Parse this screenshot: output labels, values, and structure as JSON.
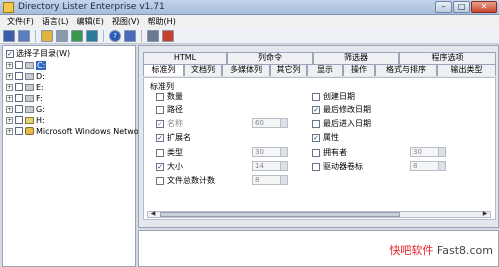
{
  "window": {
    "title": "Directory Lister Enterprise v1.71"
  },
  "menu": [
    "文件(F)",
    "语言(L)",
    "编辑(E)",
    "视图(V)",
    "帮助(H)"
  ],
  "toolbar": {
    "icons": [
      "save-icon",
      "save-all-icon",
      "open-folder-icon",
      "print-icon",
      "export-icon",
      "export-html-icon",
      "help-icon",
      "about-icon",
      "settings-icon",
      "exit-icon"
    ]
  },
  "tree": {
    "root_label": "选择子目录(W)",
    "drives": [
      {
        "label": "C:",
        "selected": true
      },
      {
        "label": "D:",
        "selected": false
      },
      {
        "label": "E:",
        "selected": false
      },
      {
        "label": "F:",
        "selected": false
      },
      {
        "label": "G:",
        "selected": false
      },
      {
        "label": "H:",
        "selected": false
      },
      {
        "label": "Microsoft Windows Network",
        "selected": false
      }
    ]
  },
  "tabs_top": [
    "HTML",
    "列命令",
    "筛选器",
    "程序选项"
  ],
  "tabs_bottom": [
    "标准列",
    "文档列",
    "多媒体列",
    "其它列",
    "显示",
    "操作",
    "格式与排序",
    "输出类型"
  ],
  "options": {
    "group_label": "标准列",
    "left": [
      {
        "label": "数量",
        "checked": false
      },
      {
        "label": "路径",
        "checked": false
      },
      {
        "label": "名称",
        "checked": true,
        "disabled": true,
        "spin": "60"
      },
      {
        "label": "扩展名",
        "checked": true
      },
      {
        "label": "类型",
        "checked": false,
        "spin": "30"
      },
      {
        "label": "大小",
        "checked": true,
        "spin": "14"
      },
      {
        "label": "文件总数计数",
        "checked": false,
        "spin": "8"
      }
    ],
    "right": [
      {
        "label": "创建日期",
        "checked": false
      },
      {
        "label": "最后修改日期",
        "checked": true
      },
      {
        "label": "最后进入日期",
        "checked": false
      },
      {
        "label": "属性",
        "checked": true
      },
      {
        "label": "拥有者",
        "checked": false,
        "spin": "30"
      },
      {
        "label": "驱动器卷标",
        "checked": false,
        "spin": "8"
      }
    ]
  },
  "watermark": {
    "part1": "快吧软件",
    "part2": "Fast8.com"
  }
}
